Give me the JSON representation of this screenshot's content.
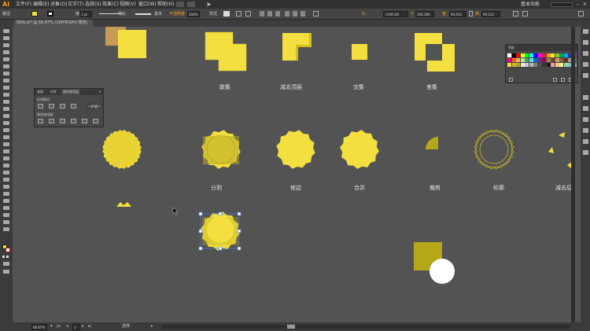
{
  "app": {
    "logo": "Ai"
  },
  "menu": [
    "文件(F)",
    "编辑(E)",
    "对象(O)",
    "文字(T)",
    "选择(S)",
    "效果(C)",
    "视图(V)",
    "窗口(W)",
    "帮助(H)"
  ],
  "workspace": "基本功能",
  "control_bar": {
    "mode_label": "路径",
    "stroke_weight": "1 pt",
    "brush_label": "等比",
    "style_label": "基本",
    "opacity_label": "不透明度",
    "opacity_value": "100%",
    "style2_label": "样式",
    "x_value": "-1190.06",
    "y_value": "304.384",
    "w_value": "66.933",
    "h_value": "69.122"
  },
  "document_tab": "00Ai.ai* @ 66.67% (CMYK/GPU 预览)",
  "status": {
    "zoom": "66.67%",
    "page": "1",
    "mode": "选择"
  },
  "pathfinder_panel": {
    "tabs": [
      "变换",
      "对齐",
      "路径查找器"
    ],
    "shape_modes_label": "形状模式：",
    "pathfinders_label": "路径查找器：",
    "expand_label": "扩展"
  },
  "swatches_panel": {
    "tabs": [
      "色板"
    ]
  },
  "canvas_labels": {
    "row1": [
      "联集",
      "减去顶层",
      "交集",
      "差集"
    ],
    "row2": [
      "分割",
      "修边",
      "合并",
      "裁剪",
      "轮廓",
      "减去后"
    ]
  },
  "colors": {
    "yellow": "#f3e040",
    "yellow_dark": "#c9b92a",
    "olive": "#b5a818",
    "tan": "#c79a55",
    "canvas": "#535353",
    "white": "#ffffff"
  }
}
